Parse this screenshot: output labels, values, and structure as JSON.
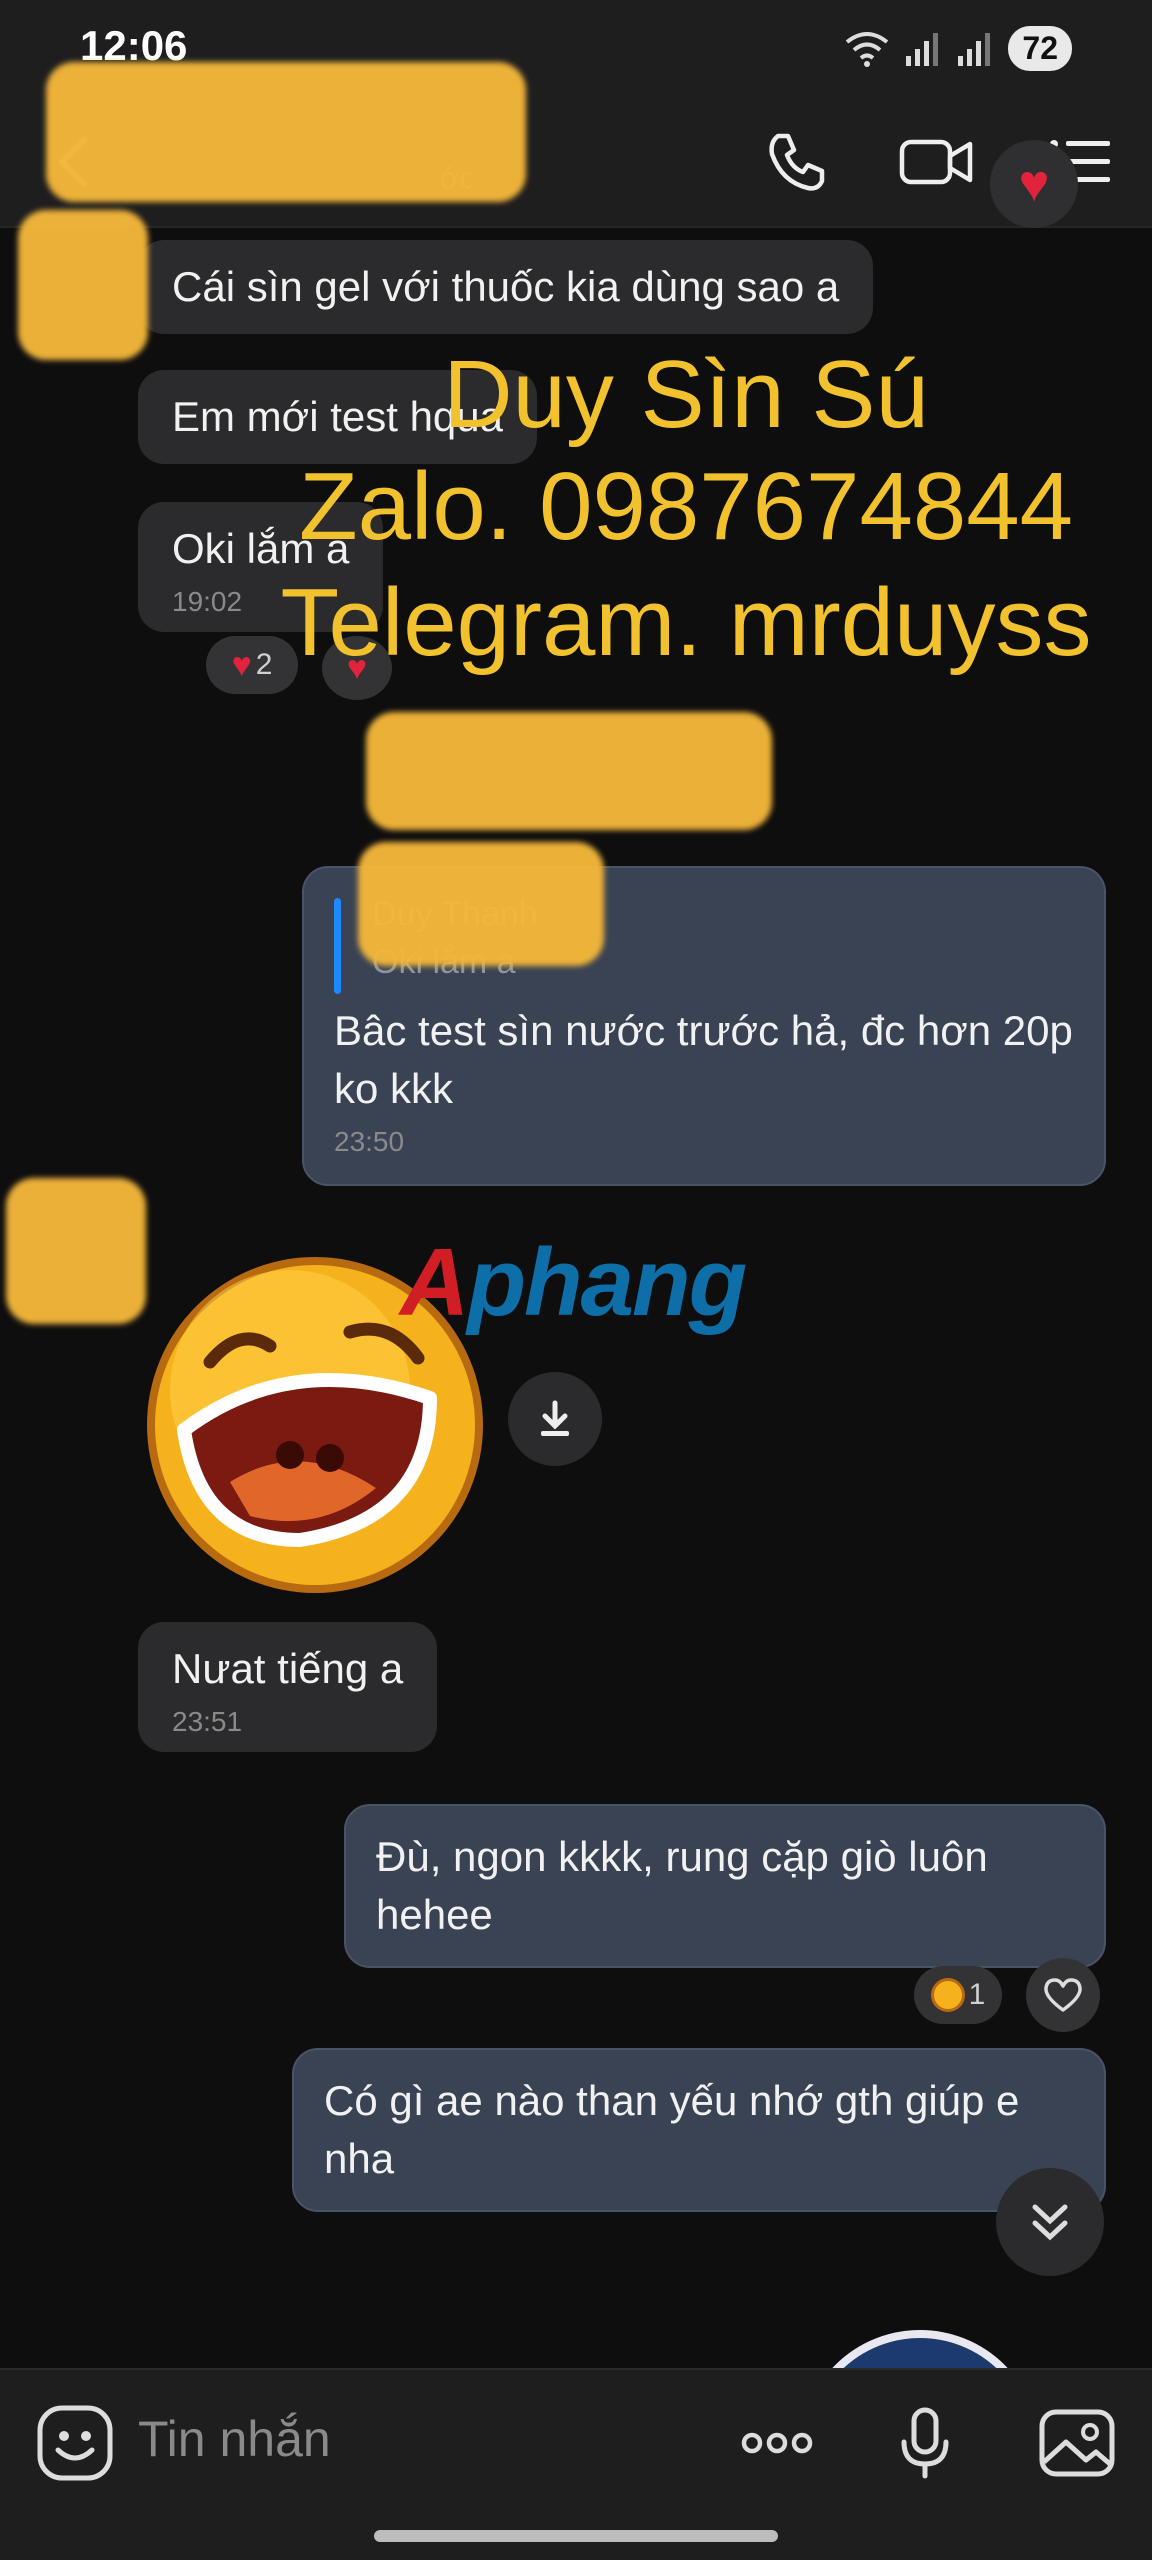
{
  "status_bar": {
    "time": "12:06",
    "battery": "72"
  },
  "header": {
    "subtitle": "ớc"
  },
  "messages": {
    "m1": {
      "text": "Cái sìn gel với thuốc kia dùng sao a"
    },
    "m2": {
      "text": "Em mới test hqua"
    },
    "m3": {
      "text": "Oki lắm a",
      "time": "19:02"
    },
    "m3_reactions": {
      "heart_count": "2"
    },
    "reply": {
      "quote_name": "Duy Thanh",
      "quote_text": "Oki lắm a",
      "text": "Bâc test sìn nước trước hả, đc hơn 20p ko kkk",
      "time": "23:50"
    },
    "m5": {
      "text": "Nưat tiếng a",
      "time": "23:51"
    },
    "m6": {
      "text": "Đù, ngon kkkk, rung cặp giò luôn hehee"
    },
    "m6_reactions": {
      "count": "1"
    },
    "m7": {
      "text": "Có gì ae nào than yếu nhớ gth giúp e nha"
    }
  },
  "watermark": {
    "line1": "Duy Sìn Sú",
    "line2": "Zalo. 0987674844",
    "line3": "Telegram. mrduyss",
    "logo_first": "A",
    "logo_rest": "phang"
  },
  "input": {
    "placeholder": "Tin nhắn"
  },
  "colors": {
    "accent": "#1e88ff",
    "heart": "#e2233c",
    "watermark": "#f2c22e",
    "outgoing_bubble": "#3a4353",
    "incoming_bubble": "#2b2b2d"
  },
  "icons": [
    "back-icon",
    "phone-icon",
    "video-call-icon",
    "menu-list-icon",
    "heart-icon",
    "download-icon",
    "chevron-double-down-icon",
    "emoji-icon",
    "more-icon",
    "mic-icon",
    "image-icon"
  ]
}
